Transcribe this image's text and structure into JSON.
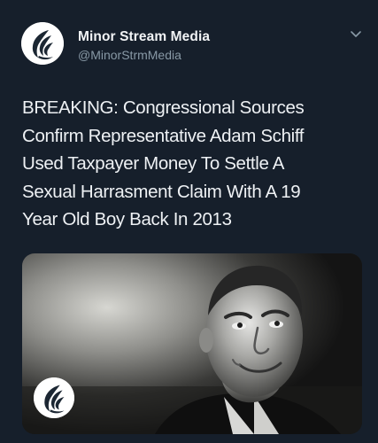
{
  "account": {
    "display_name": "Minor Stream Media",
    "handle": "@MinorStrmMedia",
    "avatar_icon": "bird-wing-logo-icon"
  },
  "menu_icon": "chevron-down-icon",
  "tweet": {
    "lines": [
      "BREAKING: Congressional Sources",
      "Confirm Representative Adam Schiff",
      "Used Taxpayer Money To Settle A",
      "Sexual Harrasment Claim With A 19",
      "Year Old Boy Back In 2013"
    ]
  },
  "media": {
    "image": "photo-of-man-smiling",
    "watermark_icon": "bird-wing-logo-icon"
  },
  "colors": {
    "background": "#161f2b",
    "name_text": "#f1f3f5",
    "handle_text": "#8899a6",
    "body_text": "#eef1f4"
  }
}
